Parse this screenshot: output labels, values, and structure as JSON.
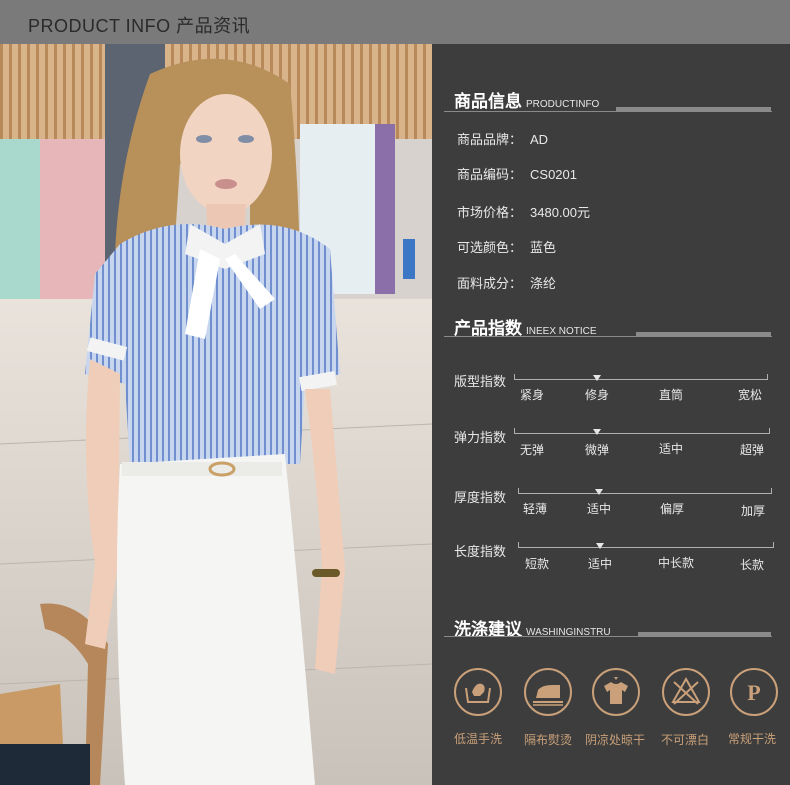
{
  "header": {
    "title": "PRODUCT INFO 产品资讯"
  },
  "product_info": {
    "heading_cn": "商品信息",
    "heading_en": "PRODUCTINFO",
    "rows": [
      {
        "label": "商品品牌：",
        "value": "AD"
      },
      {
        "label": "商品编码：",
        "value": "CS0201"
      },
      {
        "label": "市场价格：",
        "value": "3480.00元"
      },
      {
        "label": "可选颜色：",
        "value": "蓝色"
      },
      {
        "label": "面料成分：",
        "value": "涤纶"
      }
    ]
  },
  "product_index": {
    "heading_cn": "产品指数",
    "heading_en": "INEEX NOTICE",
    "indices": [
      {
        "label": "版型指数",
        "options": [
          "紧身",
          "修身",
          "直筒",
          "宽松"
        ],
        "selected": 1
      },
      {
        "label": "弹力指数",
        "options": [
          "无弹",
          "微弹",
          "适中",
          "超弹"
        ],
        "selected": 1
      },
      {
        "label": "厚度指数",
        "options": [
          "轻薄",
          "适中",
          "偏厚",
          "加厚"
        ],
        "selected": 1
      },
      {
        "label": "长度指数",
        "options": [
          "短款",
          "适中",
          "中长款",
          "长款"
        ],
        "selected": 1
      }
    ]
  },
  "washing": {
    "heading_cn": "洗涤建议",
    "heading_en": "WASHINGINSTRU",
    "accent": "#c9a079",
    "items": [
      {
        "icon": "low-temp-hand-wash-icon",
        "label": "低温手洗"
      },
      {
        "icon": "iron-with-cloth-icon",
        "label": "隔布熨烫"
      },
      {
        "icon": "shade-dry-icon",
        "label": "阴凉处晾干"
      },
      {
        "icon": "no-bleach-icon",
        "label": "不可漂白"
      },
      {
        "icon": "dry-clean-icon",
        "label": "常规干洗"
      }
    ]
  }
}
